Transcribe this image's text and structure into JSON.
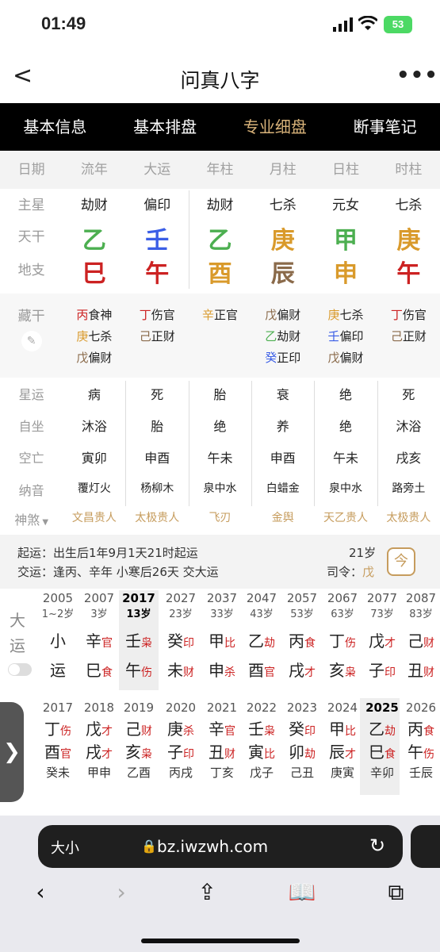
{
  "status": {
    "time": "01:49",
    "battery": "53"
  },
  "nav": {
    "title": "问真八字",
    "back": "<",
    "more": "•••"
  },
  "tabs": [
    {
      "label": "基本信息"
    },
    {
      "label": "基本排盘"
    },
    {
      "label": "专业细盘"
    },
    {
      "label": "断事笔记"
    }
  ],
  "header": [
    "日期",
    "流年",
    "大运",
    "年柱",
    "月柱",
    "日柱",
    "时柱"
  ],
  "main_star": {
    "label": "主星",
    "values": [
      "劫财",
      "偏印",
      "劫财",
      "七杀",
      "元女",
      "七杀"
    ]
  },
  "tiangan": {
    "label": "天干",
    "values": [
      "乙",
      "壬",
      "乙",
      "庚",
      "甲",
      "庚"
    ]
  },
  "dizhi": {
    "label": "地支",
    "values": [
      "巳",
      "午",
      "酉",
      "辰",
      "申",
      "午"
    ]
  },
  "canggan": {
    "label": "藏干",
    "cols": [
      [
        {
          "g": "丙",
          "s": "食神"
        },
        {
          "g": "庚",
          "s": "七杀"
        },
        {
          "g": "戊",
          "s": "偏财"
        }
      ],
      [
        {
          "g": "丁",
          "s": "伤官"
        },
        {
          "g": "己",
          "s": "正财"
        }
      ],
      [
        {
          "g": "辛",
          "s": "正官"
        }
      ],
      [
        {
          "g": "戊",
          "s": "偏财"
        },
        {
          "g": "乙",
          "s": "劫财"
        },
        {
          "g": "癸",
          "s": "正印"
        }
      ],
      [
        {
          "g": "庚",
          "s": "七杀"
        },
        {
          "g": "壬",
          "s": "偏印"
        },
        {
          "g": "戊",
          "s": "偏财"
        }
      ],
      [
        {
          "g": "丁",
          "s": "伤官"
        },
        {
          "g": "己",
          "s": "正财"
        }
      ]
    ]
  },
  "xingyun": {
    "label": "星运",
    "values": [
      "病",
      "死",
      "胎",
      "衰",
      "绝",
      "死"
    ]
  },
  "zizuo": {
    "label": "自坐",
    "values": [
      "沐浴",
      "胎",
      "绝",
      "养",
      "绝",
      "沐浴"
    ]
  },
  "kongwang": {
    "label": "空亡",
    "values": [
      "寅卯",
      "申酉",
      "午未",
      "申酉",
      "午未",
      "戌亥"
    ]
  },
  "nayin": {
    "label": "纳音",
    "values": [
      "覆灯火",
      "杨柳木",
      "泉中水",
      "白蜡金",
      "泉中水",
      "路旁土"
    ]
  },
  "shensha": {
    "label": "神煞",
    "values": [
      "文昌贵人",
      "太极贵人",
      "飞刃",
      "金舆",
      "天乙贵人",
      "太极贵人"
    ]
  },
  "qiyun": {
    "line1_label": "起运：",
    "line1": "出生后1年9月1天21时起运",
    "line2_label": "交运：",
    "line2": "逢丙、辛年 小寒后26天 交大运",
    "age": "21岁",
    "siling_label": "司令：",
    "siling": "戊"
  },
  "dayun": {
    "label_a": "大",
    "label_b": "运",
    "cols": [
      {
        "year": "2005",
        "age": "1~2岁",
        "top": "小",
        "top_s": "",
        "bot": "运",
        "bot_s": ""
      },
      {
        "year": "2007",
        "age": "3岁",
        "top": "辛",
        "top_s": "官",
        "bot": "巳",
        "bot_s": "食"
      },
      {
        "year": "2017",
        "age": "13岁",
        "top": "壬",
        "top_s": "枭",
        "bot": "午",
        "bot_s": "伤"
      },
      {
        "year": "2027",
        "age": "23岁",
        "top": "癸",
        "top_s": "印",
        "bot": "未",
        "bot_s": "财"
      },
      {
        "year": "2037",
        "age": "33岁",
        "top": "甲",
        "top_s": "比",
        "bot": "申",
        "bot_s": "杀"
      },
      {
        "year": "2047",
        "age": "43岁",
        "top": "乙",
        "top_s": "劫",
        "bot": "酉",
        "bot_s": "官"
      },
      {
        "year": "2057",
        "age": "53岁",
        "top": "丙",
        "top_s": "食",
        "bot": "戌",
        "bot_s": "才"
      },
      {
        "year": "2067",
        "age": "63岁",
        "top": "丁",
        "top_s": "伤",
        "bot": "亥",
        "bot_s": "枭"
      },
      {
        "year": "2077",
        "age": "73岁",
        "top": "戊",
        "top_s": "才",
        "bot": "子",
        "bot_s": "印"
      },
      {
        "year": "2087",
        "age": "83岁",
        "top": "己",
        "top_s": "财",
        "bot": "丑",
        "bot_s": "财"
      }
    ]
  },
  "liunian": {
    "cols": [
      {
        "year": "2017",
        "top": "丁",
        "top_s": "伤",
        "bot": "酉",
        "bot_s": "官",
        "sub": "癸未"
      },
      {
        "year": "2018",
        "top": "戊",
        "top_s": "才",
        "bot": "戌",
        "bot_s": "才",
        "sub": "甲申"
      },
      {
        "year": "2019",
        "top": "己",
        "top_s": "财",
        "bot": "亥",
        "bot_s": "枭",
        "sub": "乙酉"
      },
      {
        "year": "2020",
        "top": "庚",
        "top_s": "杀",
        "bot": "子",
        "bot_s": "印",
        "sub": "丙戌"
      },
      {
        "year": "2021",
        "top": "辛",
        "top_s": "官",
        "bot": "丑",
        "bot_s": "财",
        "sub": "丁亥"
      },
      {
        "year": "2022",
        "top": "壬",
        "top_s": "枭",
        "bot": "寅",
        "bot_s": "比",
        "sub": "戊子"
      },
      {
        "year": "2023",
        "top": "癸",
        "top_s": "印",
        "bot": "卯",
        "bot_s": "劫",
        "sub": "己丑"
      },
      {
        "year": "2024",
        "top": "甲",
        "top_s": "比",
        "bot": "辰",
        "bot_s": "才",
        "sub": "庚寅"
      },
      {
        "year": "2025",
        "top": "乙",
        "top_s": "劫",
        "bot": "巳",
        "bot_s": "食",
        "sub": "辛卯"
      },
      {
        "year": "2026",
        "top": "丙",
        "top_s": "食",
        "bot": "午",
        "bot_s": "伤",
        "sub": "壬辰"
      }
    ]
  },
  "browser": {
    "aa": "大小",
    "url": "bz.iwzwh.com"
  }
}
